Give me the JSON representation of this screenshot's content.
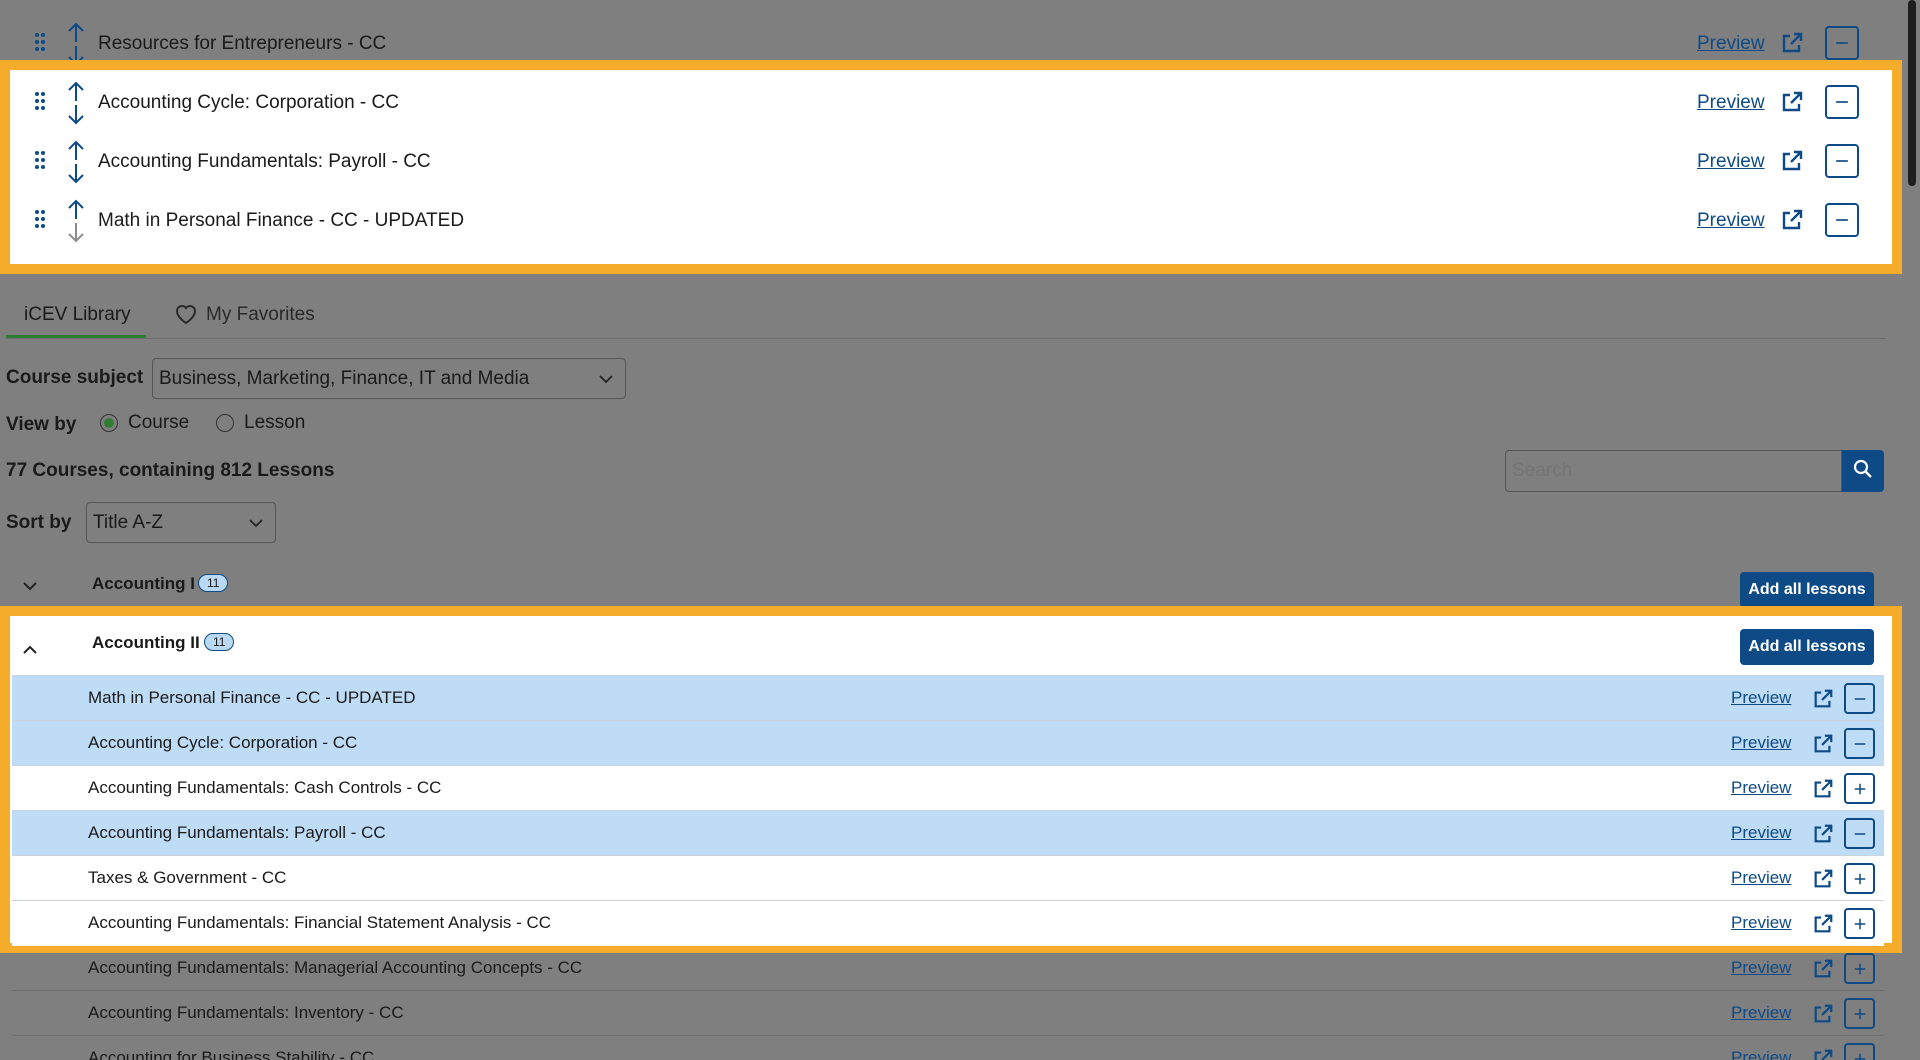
{
  "selected_list": [
    {
      "title": "Resources for Entrepreneurs - CC",
      "preview": "Preview"
    },
    {
      "title": "Accounting Cycle: Corporation - CC",
      "preview": "Preview"
    },
    {
      "title": "Accounting Fundamentals: Payroll - CC",
      "preview": "Preview"
    },
    {
      "title": "Math in Personal Finance - CC - UPDATED",
      "preview": "Preview"
    }
  ],
  "tabs": {
    "library": "iCEV Library",
    "favorites": "My Favorites"
  },
  "filters": {
    "subject_label": "Course subject",
    "subject_value": "Business, Marketing, Finance, IT and Media",
    "view_by_label": "View by",
    "view_course": "Course",
    "view_lesson": "Lesson",
    "summary": "77 Courses, containing 812 Lessons",
    "search_placeholder": "Search",
    "sort_label": "Sort by",
    "sort_value": "Title A-Z"
  },
  "courses": [
    {
      "name": "Accounting I",
      "count": "11",
      "add_label": "Add all lessons"
    },
    {
      "name": "Accounting II",
      "count": "11",
      "add_label": "Add all lessons"
    }
  ],
  "lessons": [
    {
      "title": "Math in Personal Finance - CC - UPDATED",
      "preview": "Preview"
    },
    {
      "title": "Accounting Cycle: Corporation - CC",
      "preview": "Preview"
    },
    {
      "title": "Accounting Fundamentals: Cash Controls - CC",
      "preview": "Preview"
    },
    {
      "title": "Accounting Fundamentals: Payroll - CC",
      "preview": "Preview"
    },
    {
      "title": "Taxes & Government - CC",
      "preview": "Preview"
    },
    {
      "title": "Accounting Fundamentals: Financial Statement Analysis - CC",
      "preview": "Preview"
    },
    {
      "title": "Accounting Fundamentals: Managerial Accounting Concepts - CC",
      "preview": "Preview"
    },
    {
      "title": "Accounting Fundamentals: Inventory - CC",
      "preview": "Preview"
    },
    {
      "title": "Accounting for Business Stability - CC",
      "preview": "Preview"
    }
  ],
  "colors": {
    "highlight": "#f5ac2a",
    "primary": "#0d4a86",
    "selected_row": "#bfdcf7"
  }
}
